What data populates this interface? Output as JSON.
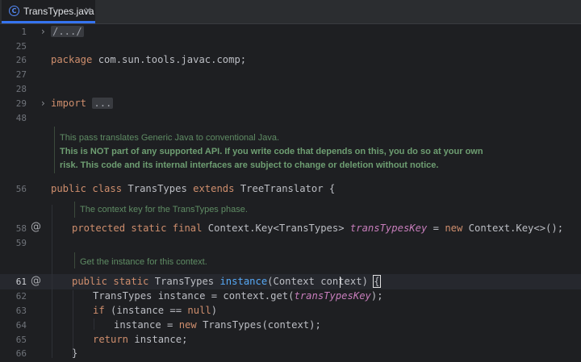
{
  "tab": {
    "icon": "C",
    "label": "TransTypes.java",
    "close": "×"
  },
  "gutter": {
    "lines": [
      "1",
      "25",
      "26",
      "27",
      "28",
      "29",
      "48",
      "56",
      "58",
      "59",
      "61",
      "62",
      "63",
      "64",
      "65",
      "66"
    ]
  },
  "code": {
    "l1_fold": "/.../",
    "l26_kw": "package",
    "l26_pkg": " com.sun.tools.javac.comp;",
    "l29_kw": "import",
    "l29_fold": "...",
    "l56_kw1": "public",
    "l56_kw2": "class",
    "l56_name": "TransTypes",
    "l56_kw3": "extends",
    "l56_rest": "TreeTranslator {",
    "l58_kw1": "protected",
    "l58_kw2": "static",
    "l58_kw3": "final",
    "l58_type": "Context.Key<TransTypes>",
    "l58_field": "transTypesKey",
    "l58_eq": " = ",
    "l58_kw4": "new",
    "l58_rest": " Context.Key<>();",
    "l61_kw1": "public",
    "l61_kw2": "static",
    "l61_type": "TransTypes",
    "l61_fn": "instance",
    "l61_rest": "(Context context) ",
    "l61_brace": "{",
    "l62_a": "TransTypes instance = context.get(",
    "l62_field": "transTypesKey",
    "l62_b": ");",
    "l63_kw": "if",
    "l63_a": " (instance == ",
    "l63_kw2": "null",
    "l63_b": ")",
    "l64_a": "instance = ",
    "l64_kw": "new",
    "l64_b": " TransTypes(context);",
    "l65_kw": "return",
    "l65_b": " instance;",
    "l66": "}"
  },
  "docs": {
    "class_doc_1": "This pass translates Generic Java to conventional Java.",
    "class_doc_2": "This is NOT part of any supported API. If you write code that depends on this, you do so at your own",
    "class_doc_3": "risk. This code and its internal interfaces are subject to change or deletion without notice.",
    "field_doc": "The context key for the TransTypes phase.",
    "method_doc": "Get the instance for this context."
  },
  "gutter_icons": {
    "override": "@"
  }
}
